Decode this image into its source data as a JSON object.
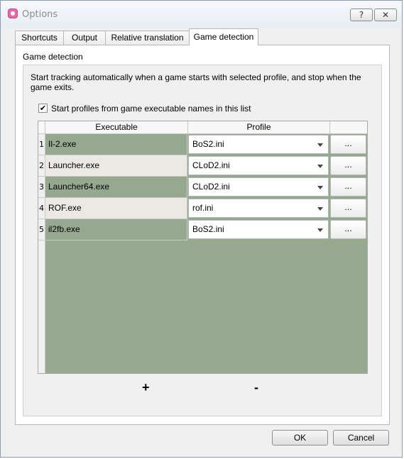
{
  "window": {
    "title": "Options",
    "help_label": "?",
    "close_label": "✕"
  },
  "tabs": [
    {
      "label": "Shortcuts",
      "active": false
    },
    {
      "label": "Output",
      "active": false
    },
    {
      "label": "Relative translation",
      "active": false
    },
    {
      "label": "Game detection",
      "active": true
    }
  ],
  "panel": {
    "group_title": "Game detection",
    "description": "Start tracking automatically when a game starts with selected profile, and stop when the game exits.",
    "checkbox_label": "Start profiles from game executable names in this list",
    "checkbox_checked": "✔"
  },
  "table": {
    "headers": [
      "Executable",
      "Profile"
    ],
    "rows": [
      {
        "num": "1",
        "exe": "Il-2.exe",
        "profile": "BoS2.ini",
        "action": "..."
      },
      {
        "num": "2",
        "exe": "Launcher.exe",
        "profile": "CLoD2.ini",
        "action": "..."
      },
      {
        "num": "3",
        "exe": "Launcher64.exe",
        "profile": "CLoD2.ini",
        "action": "..."
      },
      {
        "num": "4",
        "exe": "ROF.exe",
        "profile": "rof.ini",
        "action": "..."
      },
      {
        "num": "5",
        "exe": "il2fb.exe",
        "profile": "BoS2.ini",
        "action": "..."
      }
    ]
  },
  "controls": {
    "add_label": "+",
    "remove_label": "-"
  },
  "footer": {
    "ok_label": "OK",
    "cancel_label": "Cancel"
  },
  "colors": {
    "table_green": "#96a890",
    "row_light": "#ebe9e4"
  }
}
